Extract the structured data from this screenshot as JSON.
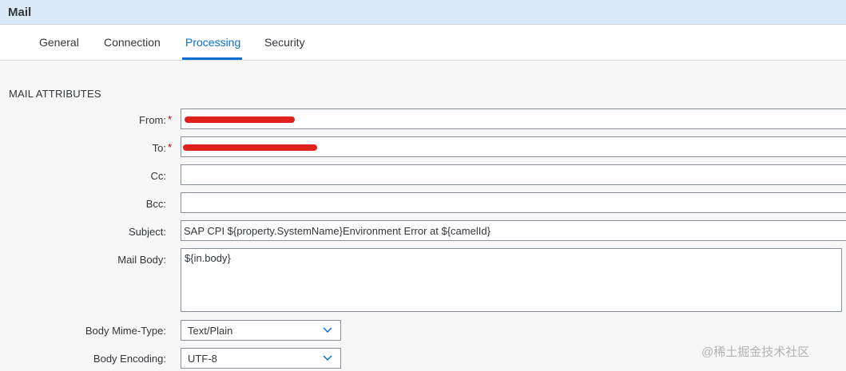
{
  "header": {
    "title": "Mail"
  },
  "tabs": [
    {
      "label": "General",
      "active": false
    },
    {
      "label": "Connection",
      "active": false
    },
    {
      "label": "Processing",
      "active": true
    },
    {
      "label": "Security",
      "active": false
    }
  ],
  "section": {
    "title": "MAIL ATTRIBUTES"
  },
  "form": {
    "from": {
      "label": "From:",
      "value": ""
    },
    "to": {
      "label": "To:",
      "value": ""
    },
    "cc": {
      "label": "Cc:",
      "value": ""
    },
    "bcc": {
      "label": "Bcc:",
      "value": ""
    },
    "subject": {
      "label": "Subject:",
      "value": "SAP CPI ${property.SystemName}Environment Error at ${camelId}"
    },
    "mail_body": {
      "label": "Mail Body:",
      "value": "${in.body}"
    },
    "body_mime_type": {
      "label": "Body Mime-Type:",
      "value": "Text/Plain"
    },
    "body_encoding": {
      "label": "Body Encoding:",
      "value": "UTF-8"
    }
  },
  "required_marker": "*",
  "colors": {
    "accent": "#0a6ed1",
    "required": "#bb0000",
    "redaction": "#e0201d"
  },
  "watermark": "@稀土掘金技术社区"
}
